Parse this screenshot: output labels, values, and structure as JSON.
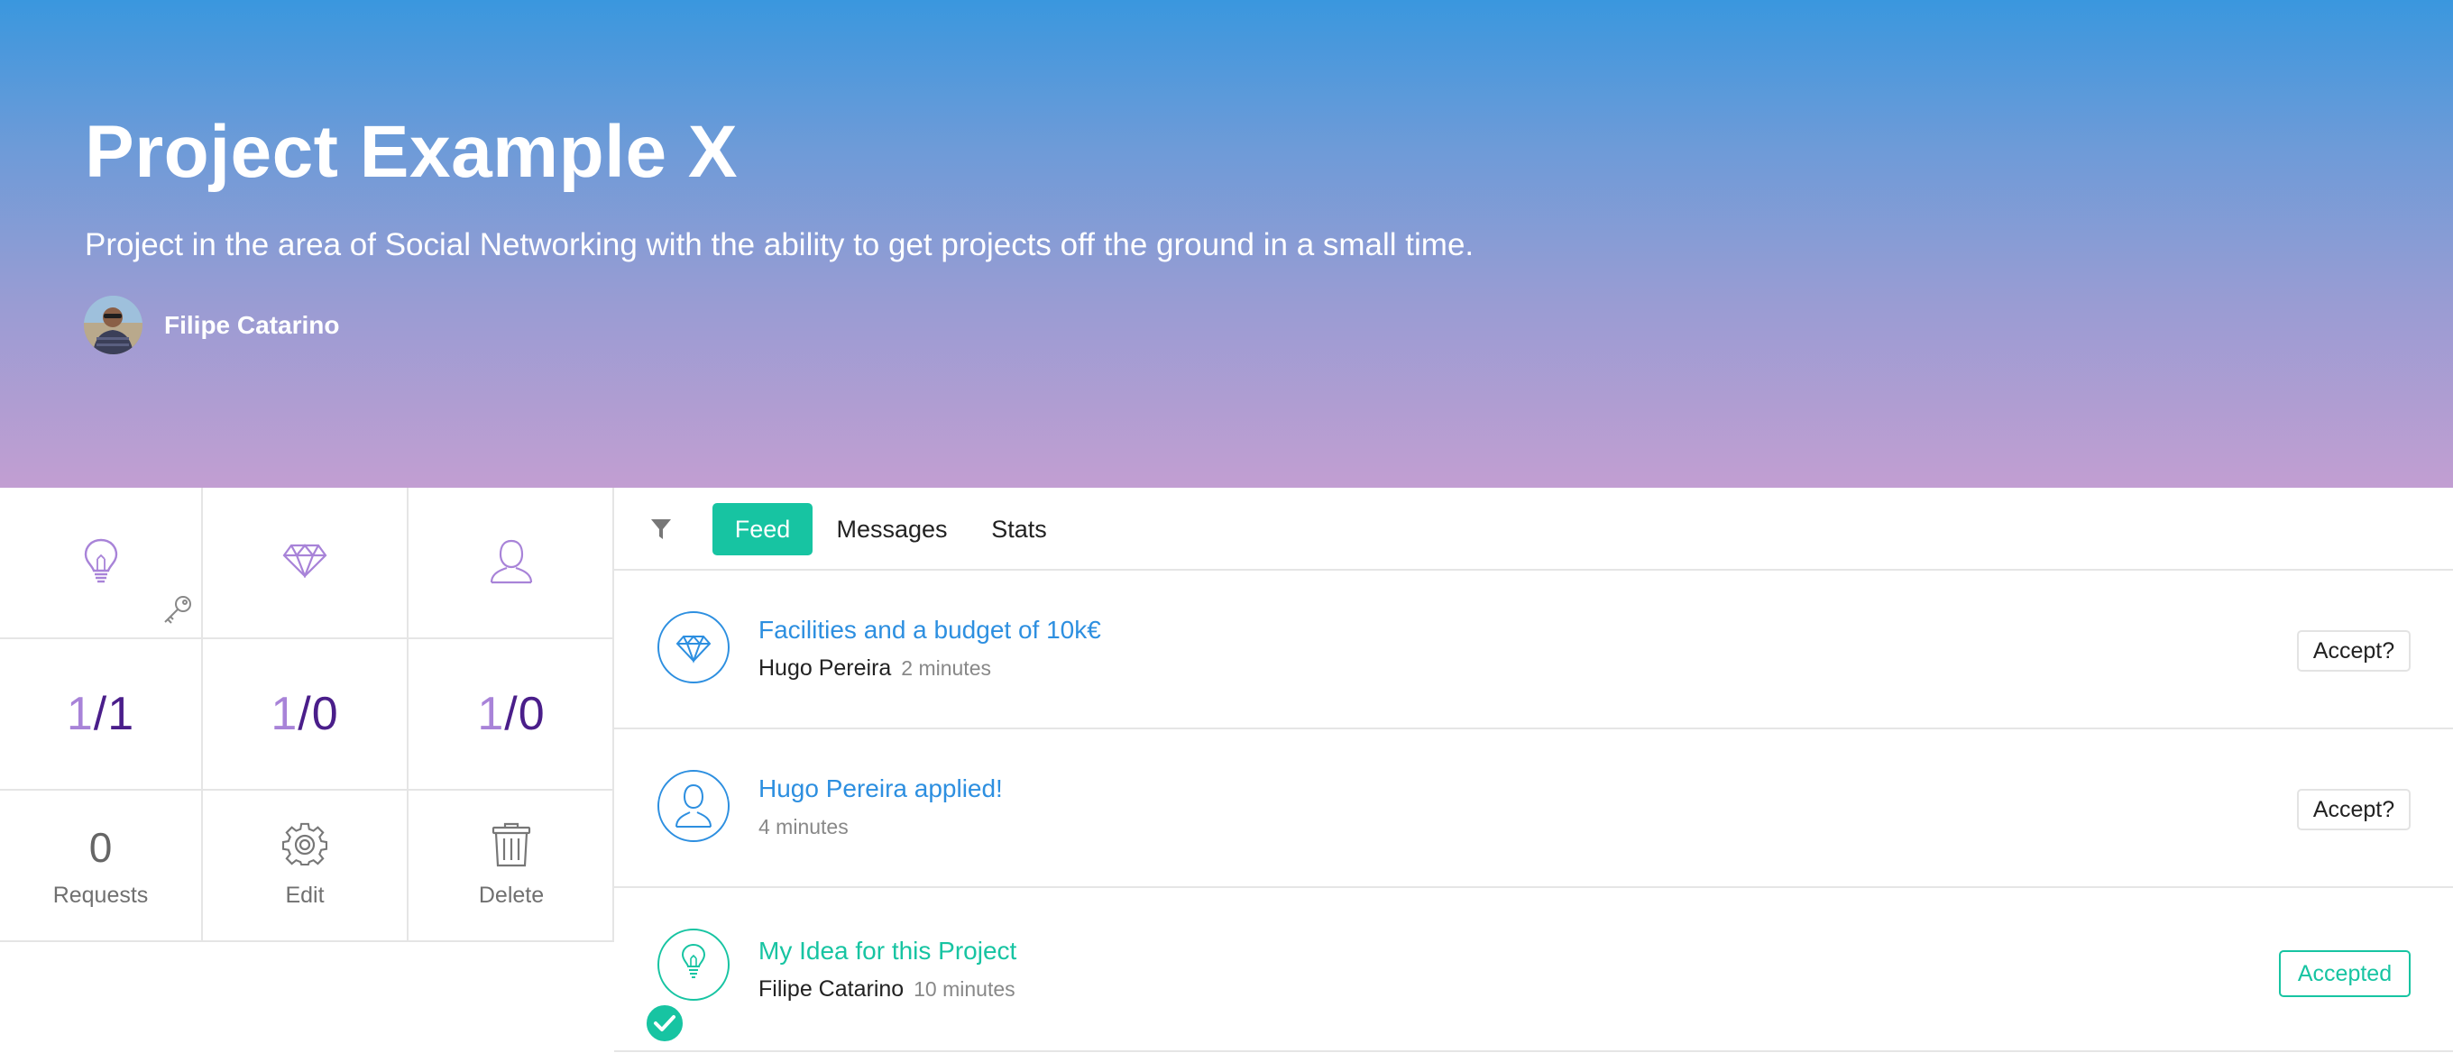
{
  "colors": {
    "accent": "#17c4a2",
    "link_blue": "#2d8fe0",
    "purple_light": "#a883d8",
    "purple_dark": "#4a1e8a",
    "hero_top": "#3a97de",
    "hero_bottom": "#c29ed2"
  },
  "hero": {
    "title": "Project Example X",
    "description": "Project in the area of Social Networking with the ability to get projects off the ground in a small time.",
    "owner_name": "Filipe Catarino"
  },
  "stats": {
    "icons": [
      "lightbulb-icon",
      "diamond-icon",
      "user-icon"
    ],
    "ratios": [
      {
        "a": "1",
        "sep": "/",
        "b": "1"
      },
      {
        "a": "1",
        "sep": "/",
        "b": "0"
      },
      {
        "a": "1",
        "sep": "/",
        "b": "0"
      }
    ],
    "requests_count": "0",
    "requests_label": "Requests",
    "edit_label": "Edit",
    "delete_label": "Delete"
  },
  "tabs": {
    "items": [
      {
        "label": "Feed",
        "active": true
      },
      {
        "label": "Messages",
        "active": false
      },
      {
        "label": "Stats",
        "active": false
      }
    ]
  },
  "feed": {
    "items": [
      {
        "icon": "diamond-icon",
        "title": "Facilities and a budget of 10k€",
        "author": "Hugo Pereira",
        "time": "2 minutes",
        "action": "Accept?",
        "state": "pending"
      },
      {
        "icon": "user-icon",
        "title": "Hugo Pereira applied!",
        "author": "",
        "time": "4 minutes",
        "action": "Accept?",
        "state": "pending"
      },
      {
        "icon": "lightbulb-icon",
        "title": "My Idea for this Project",
        "author": "Filipe Catarino",
        "time": "10 minutes",
        "action": "Accepted",
        "state": "accepted"
      }
    ]
  }
}
